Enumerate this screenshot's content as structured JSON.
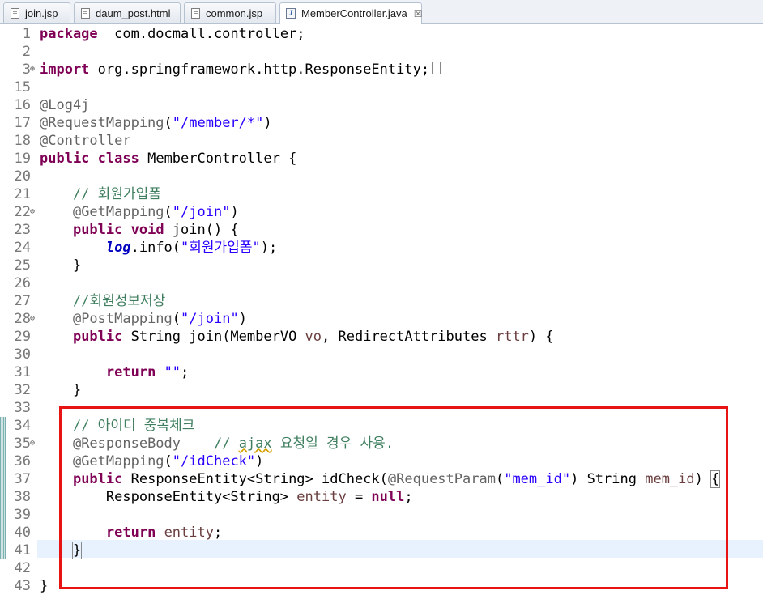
{
  "tabs": [
    {
      "label": "join.jsp",
      "icon": "file-icon"
    },
    {
      "label": "daum_post.html",
      "icon": "file-icon"
    },
    {
      "label": "common.jsp",
      "icon": "file-icon"
    },
    {
      "label": "MemberController.java",
      "icon": "java-file-icon",
      "active": true,
      "close": "☒"
    }
  ],
  "lines": [
    {
      "n": "1",
      "segs": [
        [
          "kw",
          "package"
        ],
        [
          "",
          "  com.docmall.controller;"
        ]
      ]
    },
    {
      "n": "2",
      "segs": []
    },
    {
      "n": "3",
      "fold": "⊕",
      "segs": [
        [
          "kw",
          "import"
        ],
        [
          "",
          " org.springframework.http.ResponseEntity;"
        ]
      ]
    },
    {
      "n": "15",
      "segs": []
    },
    {
      "n": "16",
      "segs": [
        [
          "ann",
          "@Log4j"
        ]
      ]
    },
    {
      "n": "17",
      "segs": [
        [
          "ann",
          "@RequestMapping"
        ],
        [
          "",
          "("
        ],
        [
          "str",
          "\"/member/*\""
        ],
        [
          "",
          ")"
        ]
      ]
    },
    {
      "n": "18",
      "segs": [
        [
          "ann",
          "@Controller"
        ]
      ]
    },
    {
      "n": "19",
      "segs": [
        [
          "kw",
          "public"
        ],
        [
          "",
          " "
        ],
        [
          "kw",
          "class"
        ],
        [
          "",
          " MemberController {"
        ]
      ]
    },
    {
      "n": "20",
      "segs": []
    },
    {
      "n": "21",
      "segs": [
        [
          "",
          "    "
        ],
        [
          "com",
          "// 회원가입폼"
        ]
      ]
    },
    {
      "n": "22",
      "fold": "⊖",
      "segs": [
        [
          "",
          "    "
        ],
        [
          "ann",
          "@GetMapping"
        ],
        [
          "",
          "("
        ],
        [
          "str",
          "\"/join\""
        ],
        [
          "",
          ")"
        ]
      ]
    },
    {
      "n": "23",
      "segs": [
        [
          "",
          "    "
        ],
        [
          "kw",
          "public"
        ],
        [
          "",
          " "
        ],
        [
          "kw",
          "void"
        ],
        [
          "",
          " join() {"
        ]
      ]
    },
    {
      "n": "24",
      "segs": [
        [
          "",
          "        "
        ],
        [
          "fld",
          "log"
        ],
        [
          "",
          ".info("
        ],
        [
          "str",
          "\"회원가입폼\""
        ],
        [
          "",
          ");"
        ]
      ]
    },
    {
      "n": "25",
      "segs": [
        [
          "",
          "    }"
        ]
      ]
    },
    {
      "n": "26",
      "segs": []
    },
    {
      "n": "27",
      "segs": [
        [
          "",
          "    "
        ],
        [
          "com",
          "//회원정보저장"
        ]
      ]
    },
    {
      "n": "28",
      "fold": "⊖",
      "segs": [
        [
          "",
          "    "
        ],
        [
          "ann",
          "@PostMapping"
        ],
        [
          "",
          "("
        ],
        [
          "str",
          "\"/join\""
        ],
        [
          "",
          ")"
        ]
      ]
    },
    {
      "n": "29",
      "segs": [
        [
          "",
          "    "
        ],
        [
          "kw",
          "public"
        ],
        [
          "",
          " String join(MemberVO "
        ],
        [
          "var",
          "vo"
        ],
        [
          "",
          ", RedirectAttributes "
        ],
        [
          "var",
          "rttr"
        ],
        [
          "",
          ") {"
        ]
      ]
    },
    {
      "n": "30",
      "segs": []
    },
    {
      "n": "31",
      "segs": [
        [
          "",
          "        "
        ],
        [
          "kw",
          "return"
        ],
        [
          "",
          " "
        ],
        [
          "str",
          "\"\""
        ],
        [
          "",
          ";"
        ]
      ]
    },
    {
      "n": "32",
      "segs": [
        [
          "",
          "    }"
        ]
      ]
    },
    {
      "n": "33",
      "segs": []
    },
    {
      "n": "34",
      "mark": true,
      "segs": [
        [
          "",
          "    "
        ],
        [
          "com",
          "// 아이디 중복체크"
        ]
      ]
    },
    {
      "n": "35",
      "mark": true,
      "fold": "⊖",
      "segs": [
        [
          "",
          "    "
        ],
        [
          "ann",
          "@ResponseBody"
        ],
        [
          "",
          "    "
        ],
        [
          "com",
          "// "
        ],
        [
          "com squig",
          "ajax"
        ],
        [
          "com",
          " 요청일 경우 사용."
        ]
      ]
    },
    {
      "n": "36",
      "mark": true,
      "segs": [
        [
          "",
          "    "
        ],
        [
          "ann",
          "@GetMapping"
        ],
        [
          "",
          "("
        ],
        [
          "str",
          "\"/idCheck\""
        ],
        [
          "",
          ")"
        ]
      ]
    },
    {
      "n": "37",
      "mark": true,
      "segs": [
        [
          "",
          "    "
        ],
        [
          "kw",
          "public"
        ],
        [
          "",
          " ResponseEntity<String> idCheck("
        ],
        [
          "ann",
          "@RequestParam"
        ],
        [
          "",
          "("
        ],
        [
          "str",
          "\"mem_id\""
        ],
        [
          "",
          ") String "
        ],
        [
          "var",
          "mem_id"
        ],
        [
          "",
          ") "
        ],
        [
          "bracket",
          "{"
        ]
      ]
    },
    {
      "n": "38",
      "mark": true,
      "segs": [
        [
          "",
          "        ResponseEntity<String> "
        ],
        [
          "var",
          "entity"
        ],
        [
          "",
          " = "
        ],
        [
          "kw",
          "null"
        ],
        [
          "",
          ";"
        ]
      ]
    },
    {
      "n": "39",
      "mark": true,
      "segs": []
    },
    {
      "n": "40",
      "mark": true,
      "segs": [
        [
          "",
          "        "
        ],
        [
          "kw",
          "return"
        ],
        [
          "",
          " "
        ],
        [
          "var",
          "entity"
        ],
        [
          "",
          ";"
        ]
      ]
    },
    {
      "n": "41",
      "mark": true,
      "current": true,
      "segs": [
        [
          "",
          "    "
        ],
        [
          "bracket",
          "}"
        ]
      ]
    },
    {
      "n": "42",
      "segs": []
    },
    {
      "n": "43",
      "segs": [
        [
          "",
          "}"
        ]
      ]
    }
  ]
}
